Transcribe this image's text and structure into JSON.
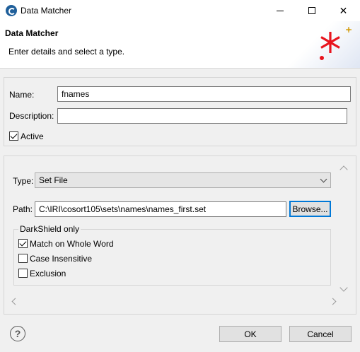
{
  "window": {
    "title": "Data Matcher",
    "controls": {
      "minimize": "minimize-icon",
      "maximize": "maximize-icon",
      "close": "✕"
    }
  },
  "banner": {
    "title": "Data Matcher",
    "message": "Enter details and select a type.",
    "logo_icon": "red-asterisk-icon",
    "logo_color": "#e8141e"
  },
  "details": {
    "name_label": "Name:",
    "name_value": "fnames",
    "description_label": "Description:",
    "description_value": "",
    "active_label": "Active",
    "active_checked": true
  },
  "type_section": {
    "type_label": "Type:",
    "type_value": "Set File",
    "path_label": "Path:",
    "path_value": "C:\\IRI\\cosort105\\sets\\names\\names_first.set",
    "browse_label": "Browse...",
    "darkshield_title": "DarkShield only",
    "options": [
      {
        "label": "Match on Whole Word",
        "checked": true
      },
      {
        "label": "Case Insensitive",
        "checked": false
      },
      {
        "label": "Exclusion",
        "checked": false
      }
    ]
  },
  "footer": {
    "help_icon": "?",
    "ok_label": "OK",
    "cancel_label": "Cancel"
  },
  "colors": {
    "accent": "#0078d7",
    "logo_red": "#e8141e",
    "logo_gold": "#d4a017"
  }
}
